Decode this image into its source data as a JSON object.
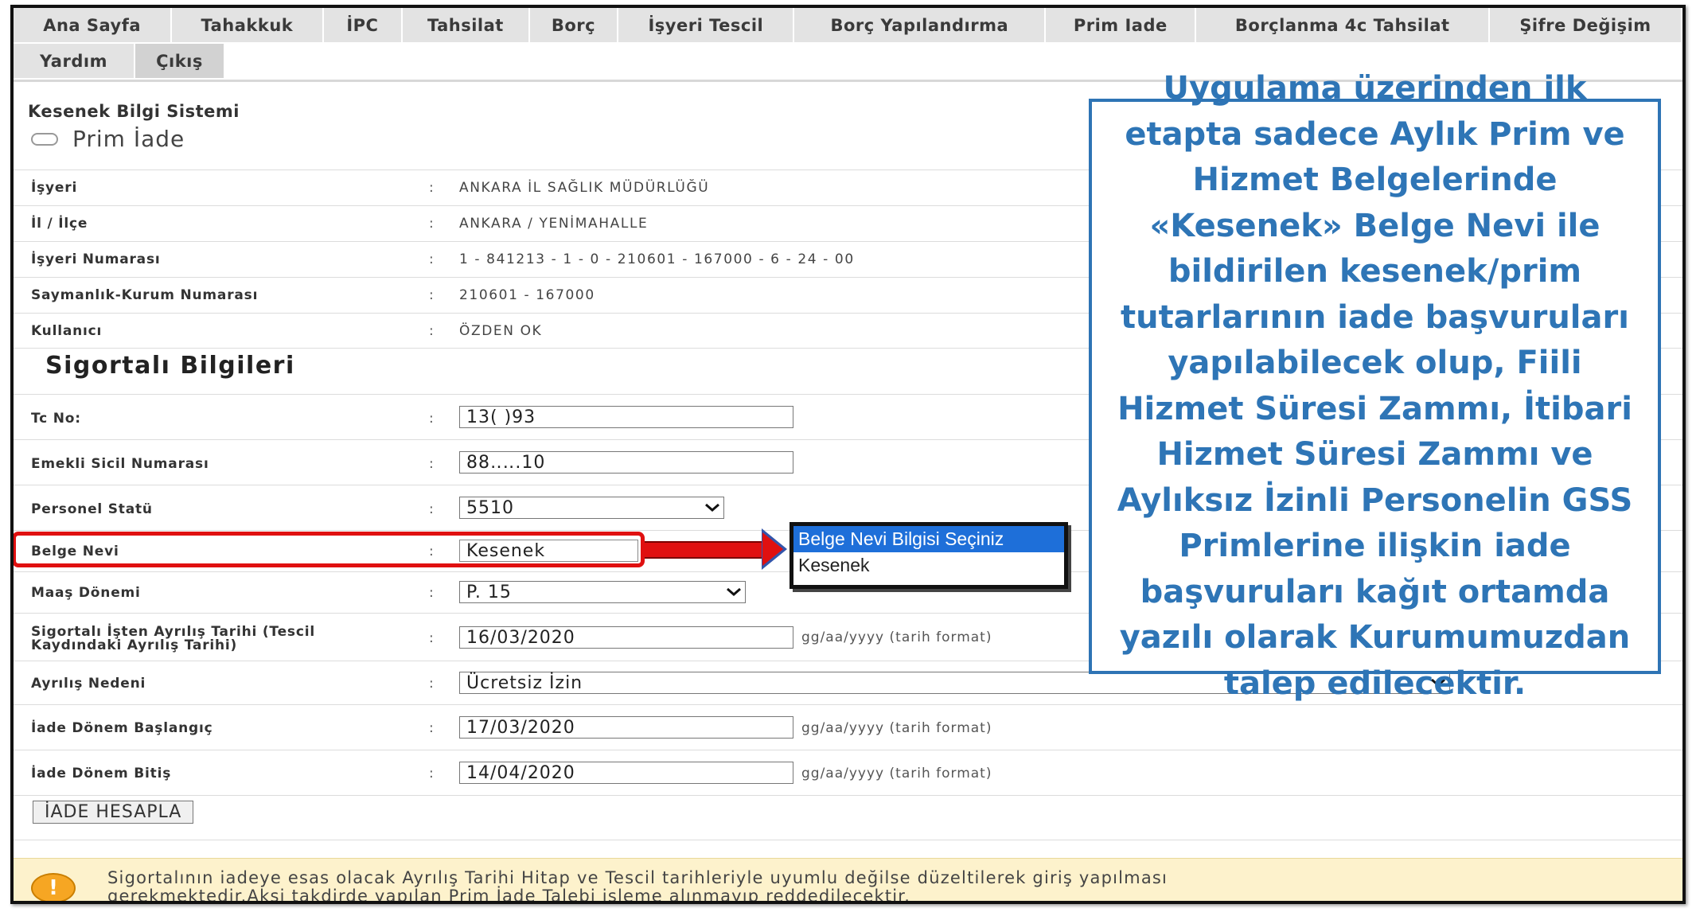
{
  "nav": {
    "row1": [
      "Ana Sayfa",
      "Tahakkuk",
      "İPC",
      "Tahsilat",
      "Borç",
      "İşyeri Tescil",
      "Borç Yapılandırma",
      "Prim Iade",
      "Borçlanma 4c Tahsilat",
      "Şifre Değişim"
    ],
    "row2": [
      "Yardım",
      "Çıkış"
    ]
  },
  "header": {
    "system_title": "Kesenek Bilgi Sistemi",
    "page_title": "Prim İade"
  },
  "info": {
    "isyeri_label": "İşyeri",
    "isyeri_value": "ANKARA İL SAĞLIK MÜDÜRLÜĞÜ",
    "il_ilce_label": "İl / İlçe",
    "il_ilce_value": "ANKARA / YENİMAHALLE",
    "isyeri_no_label": "İşyeri Numarası",
    "isyeri_no_value": "1 - 841213 - 1 - 0 - 210601 - 167000 - 6 - 24 - 00",
    "saymanlik_label": "Saymanlık-Kurum Numarası",
    "saymanlik_value": "210601 - 167000",
    "kullanici_label": "Kullanıcı",
    "kullanici_value": "ÖZDEN  OK"
  },
  "colon": ":",
  "section_title": "Sigortalı Bilgileri",
  "form": {
    "tc_label": "Tc No:",
    "tc_value": "13(          )93",
    "emekli_label": "Emekli Sicil Numarası",
    "emekli_value": "88‥‥.10",
    "statu_label": "Personel Statü",
    "statu_value": "5510",
    "belge_label": "Belge Nevi",
    "belge_value": "Kesenek",
    "maas_label": "Maaş Dönemi",
    "maas_value": "P. 15",
    "ayrilis_label_1": "Sigortalı İşten Ayrılış Tarihi (Tescil",
    "ayrilis_label_2": "Kaydındaki Ayrılış Tarihi)",
    "ayrilis_value": "16/03/2020",
    "neden_label": "Ayrılış Nedeni",
    "neden_value": "Ücretsiz İzin",
    "baslangic_label": "İade Dönem Başlangıç",
    "baslangic_value": "17/03/2020",
    "bitis_label": "İade Dönem Bitiş",
    "bitis_value": "14/04/2020",
    "date_hint": "gg/aa/yyyy (tarih format)"
  },
  "dropdown": {
    "options": [
      "Belge Nevi Bilgisi Seçiniz",
      "Kesenek"
    ],
    "selected_index": 0
  },
  "callout": {
    "text": "Uygulama üzerinden ilk etapta sadece Aylık Prim ve Hizmet Belgelerinde «Kesenek» Belge Nevi ile bildirilen kesenek/prim tutarlarının iade başvuruları yapılabilecek olup, Fiili Hizmet Süresi Zammı, İtibari Hizmet Süresi Zammı ve Aylıksız İzinli Personelin GSS Primlerine ilişkin iade başvuruları kağıt ortamda yazılı olarak Kurumumuzdan talep edilecektir.",
    "color": "#2e75b6"
  },
  "button": {
    "label": "İADE HESAPLA"
  },
  "warning": {
    "icon": "!",
    "line1": "Sigortalının iadeye esas olacak Ayrılış Tarihi Hitap ve Tescil tarihleriyle uyumlu değilse düzeltilerek giriş yapılması",
    "line2": "gerekmektedir.Aksi takdirde yapılan Prim İade Talebi işleme alınmayıp reddedilecektir."
  },
  "colors": {
    "highlight": "#e01010",
    "nav_bg": "#e3e3e3",
    "warn_bg": "#fdf2cc"
  }
}
